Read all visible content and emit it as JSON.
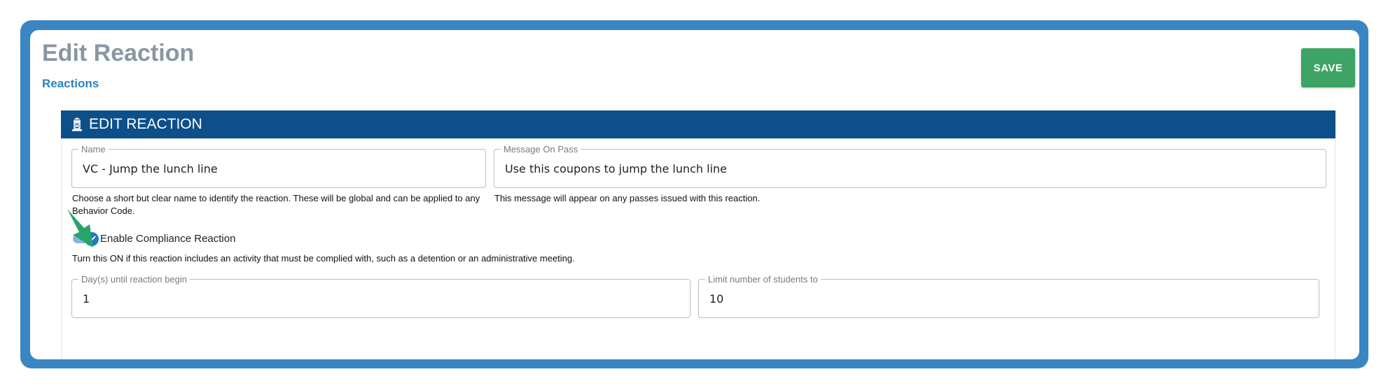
{
  "header": {
    "title": "Edit Reaction",
    "breadcrumb": "Reactions",
    "save_label": "SAVE"
  },
  "panel": {
    "title": "EDIT REACTION",
    "icon": "building-icon"
  },
  "form": {
    "name": {
      "label": "Name",
      "value": "VC - Jump the lunch line",
      "helper": "Choose a short but clear name to identify the reaction. These will be global and can be applied to any Behavior Code."
    },
    "message": {
      "label": "Message On Pass",
      "value": "Use this coupons to jump the lunch line",
      "helper": "This message will appear on any passes issued with this reaction."
    },
    "compliance": {
      "label": "Enable Compliance Reaction",
      "enabled": true,
      "helper": "Turn this ON if this reaction includes an activity that must be complied with, such as a detention or an administrative meeting."
    },
    "days": {
      "label": "Day(s) until reaction begin",
      "value": "1"
    },
    "limit": {
      "label": "Limit number of students to",
      "value": "10"
    }
  },
  "colors": {
    "frame": "#3a86c2",
    "header_bar": "#0d4f8a",
    "save_button": "#3da466",
    "toggle": "#1f78c1",
    "arrow": "#2aa36b"
  }
}
